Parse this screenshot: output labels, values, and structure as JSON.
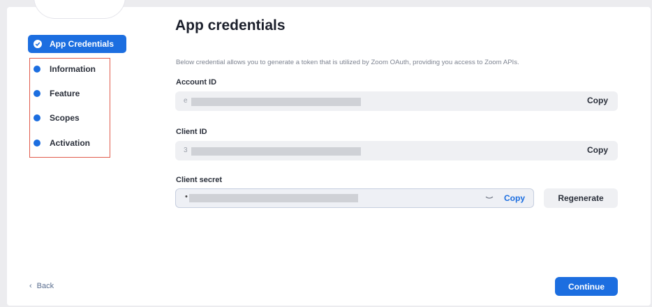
{
  "sidebar": {
    "active_item": "App Credentials",
    "items": [
      {
        "label": "Information"
      },
      {
        "label": "Feature"
      },
      {
        "label": "Scopes"
      },
      {
        "label": "Activation"
      }
    ]
  },
  "main": {
    "title": "App credentials",
    "description": "Below credential allows you to generate a token that is utilized by Zoom OAuth, providing you access to Zoom APIs.",
    "account_id": {
      "label": "Account ID",
      "value_prefix": "e",
      "copy_label": "Copy"
    },
    "client_id": {
      "label": "Client ID",
      "value_prefix": "3",
      "copy_label": "Copy"
    },
    "client_secret": {
      "label": "Client secret",
      "value_prefix": "•",
      "copy_label": "Copy",
      "regenerate_label": "Regenerate"
    }
  },
  "footer": {
    "back_label": "Back",
    "continue_label": "Continue"
  },
  "colors": {
    "accent": "#1c6ee0",
    "highlight_border": "#e05a4a"
  }
}
